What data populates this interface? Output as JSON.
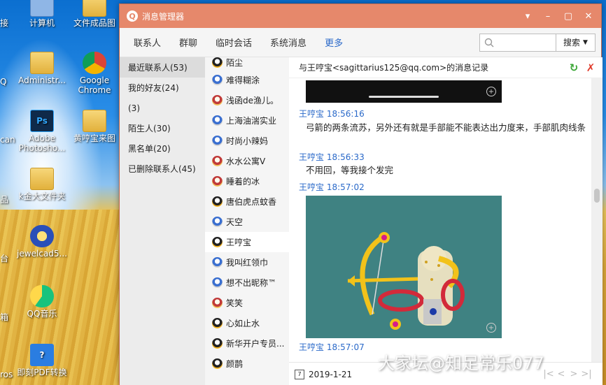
{
  "desktop": {
    "icons": [
      {
        "label": "计算机"
      },
      {
        "label": "文件成品图"
      },
      {
        "label": "Administr..."
      },
      {
        "label": "Google Chrome"
      },
      {
        "label": "Adobe Photosho..."
      },
      {
        "label": "黄哼宝来图"
      },
      {
        "label": "k金大文件夹"
      },
      {
        "label": "jewelcad5..."
      },
      {
        "label": "QQ音乐"
      },
      {
        "label": "即刻PDF转换"
      }
    ],
    "cut_labels": [
      "接",
      "Q",
      "can",
      "品",
      "台",
      "箱",
      "ros"
    ]
  },
  "window": {
    "title": "消息管理器",
    "controls": [
      "▾",
      "–",
      "▢",
      "✕"
    ]
  },
  "toolbar": {
    "tabs": [
      {
        "label": "联系人",
        "active": false
      },
      {
        "label": "群聊",
        "active": false
      },
      {
        "label": "临时会话",
        "active": false
      },
      {
        "label": "系统消息",
        "active": false
      },
      {
        "label": "更多",
        "active": true
      }
    ],
    "search_placeholder": "",
    "search_button": "搜索"
  },
  "categories": [
    {
      "label": "最近联系人(53)",
      "selected": true
    },
    {
      "label": "我的好友(24)",
      "selected": false
    },
    {
      "label": "(3)",
      "selected": false
    },
    {
      "label": "陌生人(30)",
      "selected": false
    },
    {
      "label": "黑名单(20)",
      "selected": false
    },
    {
      "label": "已删除联系人(45)",
      "selected": false
    }
  ],
  "contacts": [
    {
      "name": "陌尘"
    },
    {
      "name": "难得糊涂"
    },
    {
      "name": "浅函de渔儿。"
    },
    {
      "name": "上海油湍实业"
    },
    {
      "name": "时尚小辣妈"
    },
    {
      "name": "水水公寓V"
    },
    {
      "name": "睡着的冰"
    },
    {
      "name": "唐伯虎点蚊香"
    },
    {
      "name": "天空"
    },
    {
      "name": "王哼宝"
    },
    {
      "name": "我叫红领巾"
    },
    {
      "name": "想不出昵称™"
    },
    {
      "name": "笑笑"
    },
    {
      "name": "心如止水"
    },
    {
      "name": "新华开户专员..."
    },
    {
      "name": "颜鹊"
    }
  ],
  "messages": {
    "header": "与王哼宝<sagittarius125@qq.com>的消息记录",
    "entries": [
      {
        "sender": "王哼宝",
        "time": "18:56:16",
        "text": "弓箭的两条流苏，另外还有就是手部能不能表达出力度来，手部肌肉线条"
      },
      {
        "sender": "王哼宝",
        "time": "18:56:33",
        "text": "不用回，等我接个发完"
      },
      {
        "sender": "王哼宝",
        "time": "18:57:02",
        "text": ""
      },
      {
        "sender": "王哼宝",
        "time": "18:57:07",
        "text": ""
      }
    ],
    "date": "2019-1-21"
  },
  "watermark": "大家坛@知足常乐077",
  "colors": {
    "titlebar": "#e6886b",
    "accent": "#2a69c9"
  }
}
